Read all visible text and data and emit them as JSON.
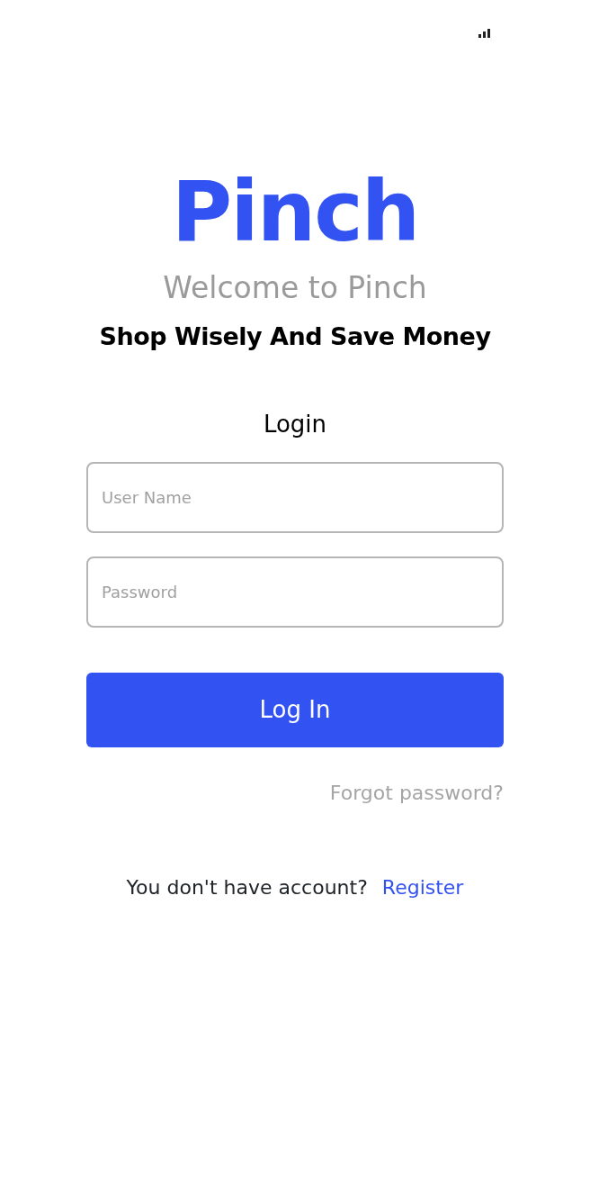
{
  "logo": "Pinch",
  "welcome": "Welcome to Pinch",
  "tagline": "Shop Wisely And Save Money",
  "form_title": "Login",
  "fields": [
    {
      "placeholder": "User Name"
    },
    {
      "placeholder": "Password"
    }
  ],
  "login_button": "Log In",
  "forgot_link": "Forgot password?",
  "register_prompt": "You don't have account?",
  "register_link": "Register"
}
